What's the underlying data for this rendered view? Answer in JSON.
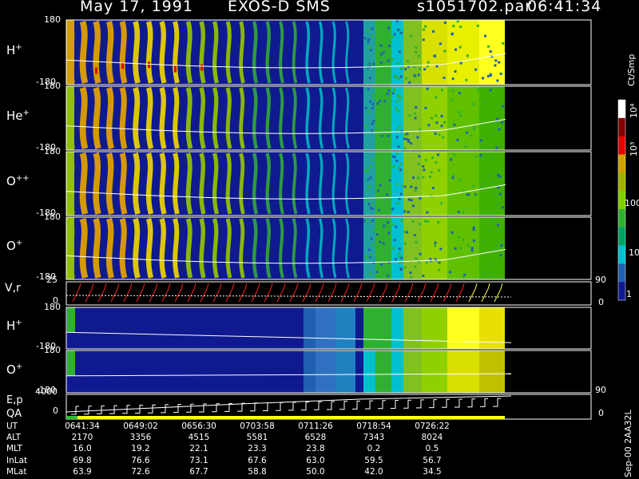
{
  "header": {
    "date": "May 17, 1991",
    "instrument": "EXOS-D SMS",
    "file": "s1051702.par",
    "time": "06:41:34"
  },
  "colorbar": {
    "unit": "Ct/Smp",
    "labels": [
      "10⁴",
      "10³",
      "100",
      "10",
      "1"
    ],
    "colors": [
      "#ffffff",
      "#800000",
      "#e00000",
      "#d0a000",
      "#a0b000",
      "#80d000",
      "#30b030",
      "#00a060",
      "#00c0d0",
      "#2060b0",
      "#101a90"
    ]
  },
  "footer_id": "Sep-00 2AA32L",
  "chart_data": [
    {
      "type": "heatmap",
      "panels": [
        {
          "name": "H+",
          "label": "H",
          "sup": "+",
          "ylim": [
            -180,
            180
          ],
          "tick_top": "180",
          "tick_bottom": "-180",
          "background_color": "#101a90"
        },
        {
          "name": "He+",
          "label": "He",
          "sup": "+",
          "ylim": [
            -180,
            180
          ],
          "tick_top": "180",
          "tick_bottom": "-180",
          "background_color": "#101a90"
        },
        {
          "name": "O++",
          "label": "O",
          "sup": "++",
          "ylim": [
            -180,
            180
          ],
          "tick_top": "180",
          "tick_bottom": "-180",
          "background_color": "#101a90"
        },
        {
          "name": "O+",
          "label": "O",
          "sup": "+",
          "ylim": [
            -180,
            180
          ],
          "tick_top": "180",
          "tick_bottom": "-180",
          "background_color": "#101a90"
        }
      ]
    },
    {
      "type": "line",
      "name": "V,r",
      "label": "V,r",
      "ylim": [
        0,
        25
      ],
      "tick_top": "25",
      "tick_bottom": "0",
      "right_ticks": [
        "90",
        "0"
      ],
      "series_colors": [
        "#ff2020",
        "#ffff40"
      ]
    },
    {
      "type": "heatmap",
      "panels": [
        {
          "name": "H+",
          "label": "H",
          "sup": "+",
          "ylim": [
            -180,
            180
          ],
          "tick_top": "180",
          "tick_bottom": "-180"
        },
        {
          "name": "O+",
          "label": "O",
          "sup": "+",
          "ylim": [
            -180,
            180
          ],
          "tick_top": "180",
          "tick_bottom": "-180"
        }
      ]
    },
    {
      "type": "line",
      "name": "E,p QA",
      "label_top": "E,p",
      "label_bottom": "QA",
      "ylim": [
        0,
        4000
      ],
      "tick_top": "4000",
      "tick_bottom": "0",
      "right_ticks": [
        "90",
        "0"
      ]
    },
    {
      "type": "table",
      "rows": [
        {
          "label": "UT",
          "values": [
            "0641:34",
            "0649:02",
            "0656:30",
            "0703:58",
            "0711:26",
            "0718:54",
            "0726:22"
          ]
        },
        {
          "label": "ALT",
          "values": [
            "2170",
            "3356",
            "4515",
            "5581",
            "6528",
            "7343",
            "8024"
          ]
        },
        {
          "label": "MLT",
          "values": [
            "16.0",
            "19.2",
            "22.1",
            "23.3",
            "23.8",
            "0.2",
            "0.5"
          ]
        },
        {
          "label": "InLat",
          "values": [
            "69.8",
            "76.6",
            "73.1",
            "67.6",
            "63.0",
            "59.5",
            "56.7"
          ]
        },
        {
          "label": "MLat",
          "values": [
            "63.9",
            "72.6",
            "67.7",
            "58.8",
            "50.0",
            "42.0",
            "34.5"
          ]
        }
      ]
    }
  ]
}
